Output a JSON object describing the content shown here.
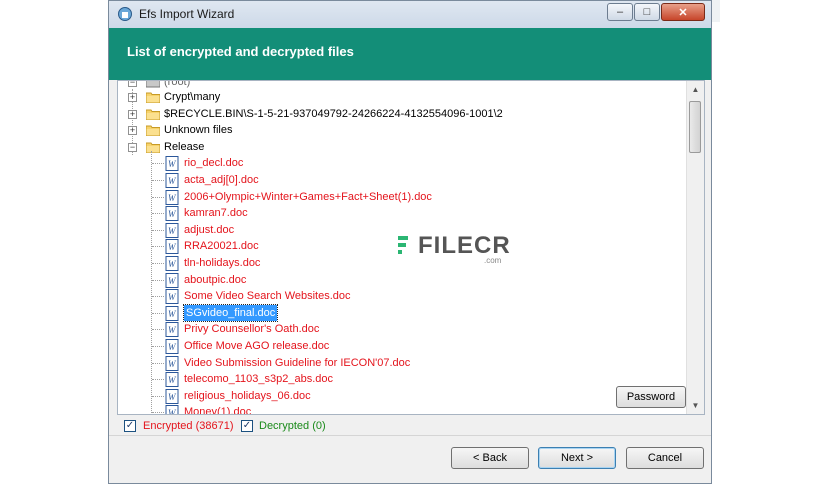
{
  "window": {
    "title": "Efs Import Wizard",
    "min_symbol": "–",
    "max_symbol": "□",
    "close_symbol": "✕"
  },
  "header": {
    "title": "List of encrypted and decrypted files"
  },
  "tree": {
    "root_label": "(root)",
    "folders": [
      {
        "label": "Crypt\\many",
        "expanded": false
      },
      {
        "label": "$RECYCLE.BIN\\S-1-5-21-937049792-24266224-4132554096-1001\\2",
        "expanded": false
      },
      {
        "label": "Unknown files",
        "expanded": false
      },
      {
        "label": "Release",
        "expanded": true
      }
    ],
    "files": [
      {
        "label": "rio_decl.doc",
        "selected": false
      },
      {
        "label": "acta_adj[0].doc",
        "selected": false
      },
      {
        "label": "2006+Olympic+Winter+Games+Fact+Sheet(1).doc",
        "selected": false
      },
      {
        "label": "kamran7.doc",
        "selected": false
      },
      {
        "label": "adjust.doc",
        "selected": false
      },
      {
        "label": "RRA20021.doc",
        "selected": false
      },
      {
        "label": "tln-holidays.doc",
        "selected": false
      },
      {
        "label": "aboutpic.doc",
        "selected": false
      },
      {
        "label": "Some Video Search Websites.doc",
        "selected": false
      },
      {
        "label": "SGvideo_final.doc",
        "selected": true
      },
      {
        "label": "Privy Counsellor's Oath.doc",
        "selected": false
      },
      {
        "label": "Office Move AGO release.doc",
        "selected": false
      },
      {
        "label": "Video Submission Guideline for IECON'07.doc",
        "selected": false
      },
      {
        "label": "telecomo_1103_s3p2_abs.doc",
        "selected": false
      },
      {
        "label": "religious_holidays_06.doc",
        "selected": false
      },
      {
        "label": "Money(1).doc",
        "selected": false
      }
    ]
  },
  "buttons": {
    "password": "Password",
    "back": "< Back",
    "next": "Next >",
    "cancel": "Cancel"
  },
  "filters": {
    "encrypted": {
      "label": "Encrypted (38671)",
      "checked": true,
      "color": "#e4141c"
    },
    "decrypted": {
      "label": "Decrypted (0)",
      "checked": true,
      "color": "#1a8a1a"
    }
  },
  "watermark": {
    "text": "FILECR",
    "sub": ".com"
  },
  "colors": {
    "header": "#138e78",
    "file_text": "#e4141c",
    "selection": "#3399ff"
  },
  "icons": {
    "folder": "folder-icon",
    "document": "word-document-icon"
  }
}
